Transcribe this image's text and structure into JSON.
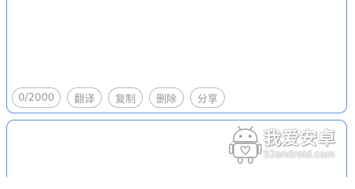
{
  "input": {
    "value": "",
    "counter": "0/2000"
  },
  "actions": [
    {
      "label": "翻译"
    },
    {
      "label": "复制"
    },
    {
      "label": "删除"
    },
    {
      "label": "分享"
    }
  ],
  "output": {
    "value": ""
  },
  "watermark": {
    "title": "我爱安卓",
    "subtitle": "52android.com"
  },
  "colors": {
    "border_accent": "#5b90d6",
    "chip_border": "#b8b8b8",
    "chip_text": "#9a9a9a"
  }
}
